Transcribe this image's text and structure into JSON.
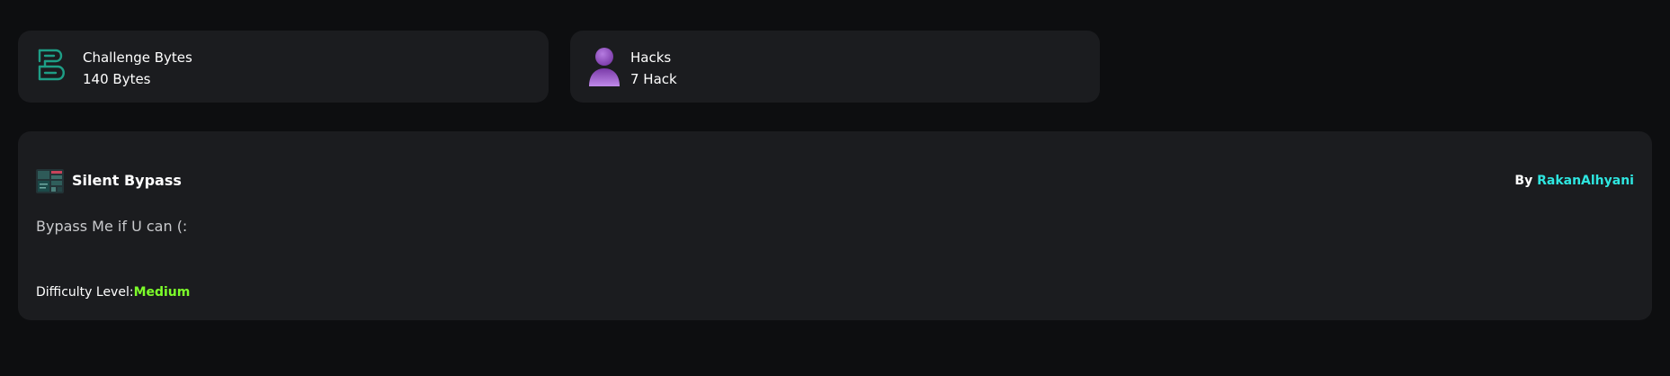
{
  "stats": {
    "bytes": {
      "label": "Challenge Bytes",
      "value": "140 Bytes",
      "icon": "bytes-logo-icon",
      "color": "#1e9e86"
    },
    "hacks": {
      "label": "Hacks",
      "value": "7 Hack",
      "icon": "user-icon",
      "color": "#9b59c9"
    }
  },
  "challenge": {
    "icon": "challenge-thumbnail-icon",
    "title": "Silent Bypass",
    "author_prefix": "By",
    "author": "RakanAlhyani",
    "description": "Bypass Me if U can (:",
    "difficulty_label": "Difficulty Level:",
    "difficulty_value": "Medium"
  },
  "colors": {
    "background": "#0d0e10",
    "card": "#1b1c1f",
    "author": "#2ee6e0",
    "difficulty": "#7dff2a"
  }
}
